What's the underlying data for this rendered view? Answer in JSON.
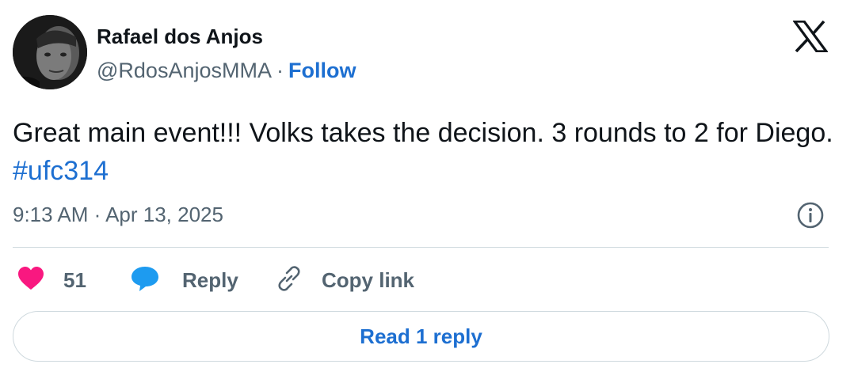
{
  "author": {
    "display_name": "Rafael dos Anjos",
    "handle": "@RdosAnjosMMA",
    "separator": "·",
    "follow_label": "Follow"
  },
  "tweet": {
    "text_before": "Great main event!!! Volks takes the decision. 3 rounds to 2 for Diego.",
    "hashtag": "#ufc314",
    "timestamp": "9:13 AM · Apr 13, 2025"
  },
  "actions": {
    "like_count": "51",
    "reply_label": "Reply",
    "copy_link_label": "Copy link"
  },
  "read_reply_label": "Read 1 reply",
  "icons": {
    "brand": "x-logo-icon",
    "info": "info-icon",
    "like": "heart-icon",
    "reply": "speech-bubble-icon",
    "copy": "link-icon"
  },
  "colors": {
    "link_blue": "#1d6fd1",
    "muted_gray": "#536471",
    "heart_pink": "#f91880",
    "reply_blue": "#1d9bf0",
    "border": "#cfd9de"
  }
}
